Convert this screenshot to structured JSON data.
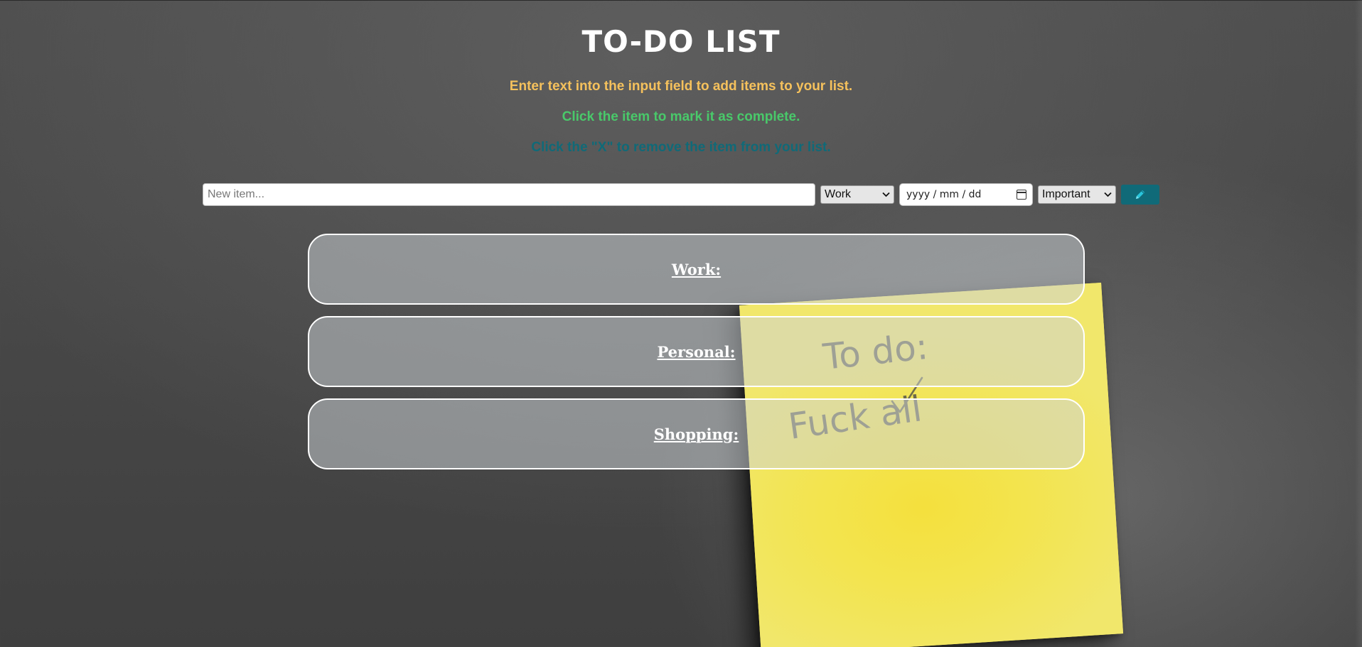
{
  "page": {
    "title": "TO-DO LIST"
  },
  "instructions": {
    "add": "Enter text into the input field to add items to your list.",
    "complete": "Click the item to mark it as complete.",
    "remove": "Click the \"X\" to remove the item from your list."
  },
  "form": {
    "item_placeholder": "New item...",
    "item_value": "",
    "category_selected": "Work",
    "date_placeholder": "yyyy / mm / dd",
    "priority_selected": "Important",
    "add_button_icon": "pencil-icon"
  },
  "categories": [
    {
      "label": "Work:"
    },
    {
      "label": "Personal:"
    },
    {
      "label": "Shopping:"
    }
  ],
  "sticky_note": {
    "line1": "To do:",
    "line2": "Fuck all"
  },
  "colors": {
    "title": "#ffffff",
    "instruction_add": "#f5c15c",
    "instruction_complete": "#49c96a",
    "instruction_remove": "#106a78",
    "add_button": "#106a78",
    "sticky_note": "#f3e44e"
  }
}
